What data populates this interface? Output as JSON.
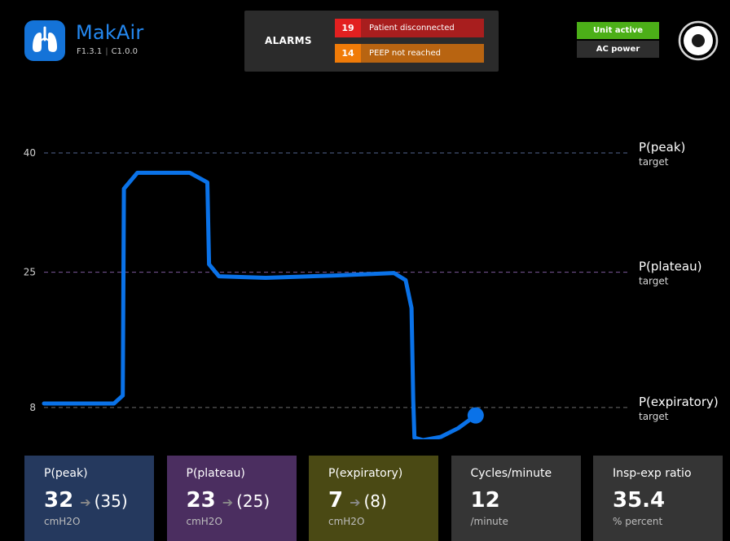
{
  "brand": {
    "name": "MakAir",
    "firmware": "F1.3.1",
    "control": "C1.0.0"
  },
  "alarms": {
    "title": "ALARMS",
    "items": [
      {
        "code": "19",
        "label": "Patient disconnected",
        "code_color": "#e22020",
        "label_color": "#a81e1e"
      },
      {
        "code": "14",
        "label": "PEEP not reached",
        "code_color": "#f07b08",
        "label_color": "#b86411"
      }
    ]
  },
  "status": {
    "unit": "Unit active",
    "unit_color": "#4caf18",
    "power": "AC power"
  },
  "chart_data": {
    "type": "line",
    "title": "",
    "xlabel": "",
    "ylabel": "",
    "y_ticks": [
      40,
      25,
      8
    ],
    "y_tick_labels": [
      "40",
      "25",
      "8"
    ],
    "ylim": [
      4,
      49
    ],
    "xlim": [
      0,
      100
    ],
    "grid": false,
    "line_color": "#0a72e8",
    "reference_lines": [
      {
        "value": 40,
        "label": "P(peak)",
        "sublabel": "target",
        "color": "#556690"
      },
      {
        "value": 25,
        "label": "P(plateau)",
        "sublabel": "target",
        "color": "#7b5a9c"
      },
      {
        "value": 8,
        "label": "P(expiratory)",
        "sublabel": "target",
        "color": "#6d6d6d"
      }
    ],
    "series": [
      {
        "x": [
          0,
          12,
          13.5,
          13.7,
          16,
          25,
          28,
          28.3,
          30,
          38,
          50,
          60,
          62,
          63,
          63.3,
          63.5,
          65,
          68,
          71,
          74
        ],
        "y": [
          8.5,
          8.5,
          9.5,
          35.5,
          37.5,
          37.5,
          36.3,
          26,
          24.5,
          24.3,
          24.6,
          24.9,
          24,
          20.5,
          9,
          4.2,
          3.9,
          4.3,
          5.4,
          7
        ]
      }
    ],
    "end_marker": {
      "x": 74,
      "y": 7
    }
  },
  "tiles": [
    {
      "label": "P(peak)",
      "value": "32",
      "arrow": "➔",
      "target": "(35)",
      "unit": "cmH2O",
      "color": "#25395e"
    },
    {
      "label": "P(plateau)",
      "value": "23",
      "arrow": "➔",
      "target": "(25)",
      "unit": "cmH2O",
      "color": "#4b2e60"
    },
    {
      "label": "P(expiratory)",
      "value": "7",
      "arrow": "➔",
      "target": "(8)",
      "unit": "cmH2O",
      "color": "#4a4914"
    },
    {
      "label": "Cycles/minute",
      "value": "12",
      "unit": "/minute",
      "color": "#353535"
    },
    {
      "label": "Insp-exp ratio",
      "value": "35.4",
      "unit": "% percent",
      "color": "#353535"
    }
  ]
}
